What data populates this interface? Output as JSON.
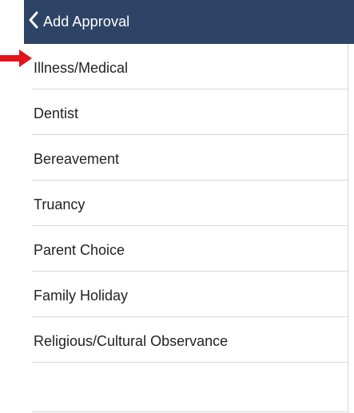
{
  "header": {
    "title": "Add Approval",
    "back_icon": "chevron-left-icon",
    "background": "#2e4467"
  },
  "list": {
    "items": [
      {
        "label": "Illness/Medical"
      },
      {
        "label": "Dentist"
      },
      {
        "label": "Bereavement"
      },
      {
        "label": "Truancy"
      },
      {
        "label": "Parent Choice"
      },
      {
        "label": "Family Holiday"
      },
      {
        "label": "Religious/Cultural Observance"
      }
    ]
  },
  "annotation": {
    "arrow_icon": "red-arrow-icon",
    "color": "#e3121b"
  }
}
